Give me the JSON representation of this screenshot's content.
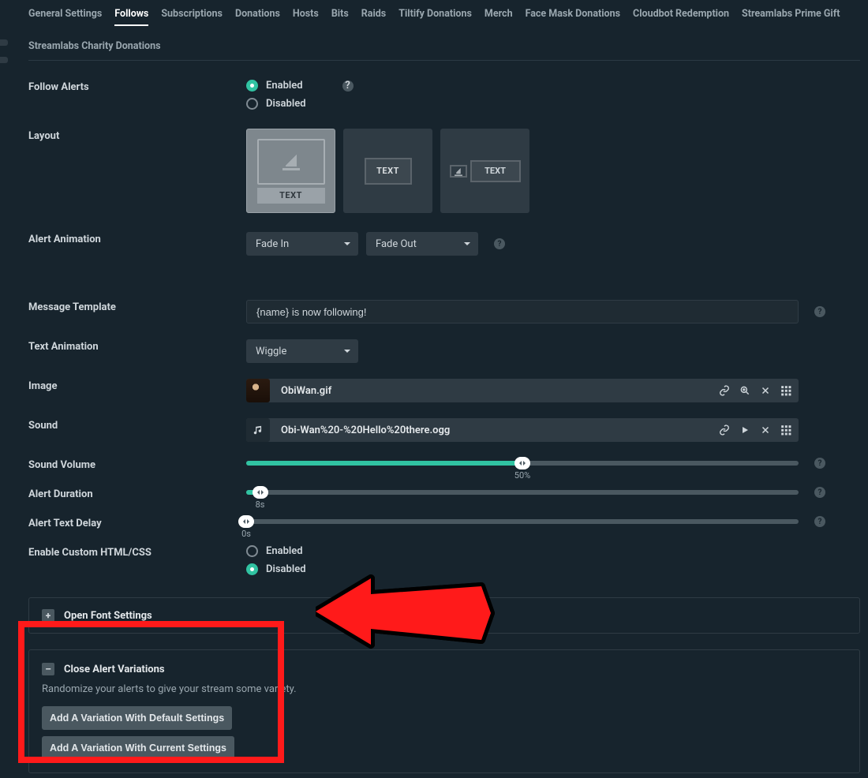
{
  "tabs": [
    "General Settings",
    "Follows",
    "Subscriptions",
    "Donations",
    "Hosts",
    "Bits",
    "Raids",
    "Tiltify Donations",
    "Merch",
    "Face Mask Donations",
    "Cloudbot Redemption",
    "Streamlabs Prime Gift",
    "Streamlabs Charity Donations"
  ],
  "active_tab": "Follows",
  "labels": {
    "follow_alerts": "Follow Alerts",
    "layout": "Layout",
    "alert_animation": "Alert Animation",
    "message_template": "Message Template",
    "text_animation": "Text Animation",
    "image": "Image",
    "sound": "Sound",
    "sound_volume": "Sound Volume",
    "alert_duration": "Alert Duration",
    "alert_text_delay": "Alert Text Delay",
    "custom_html": "Enable Custom HTML/CSS"
  },
  "radios": {
    "enabled": "Enabled",
    "disabled": "Disabled"
  },
  "follow_alerts_value": "Enabled",
  "custom_html_value": "Disabled",
  "layout_text": "TEXT",
  "alert_animation": {
    "in": "Fade In",
    "out": "Fade Out"
  },
  "message_template_value": "{name} is now following!",
  "text_animation_value": "Wiggle",
  "image_file": "ObiWan.gif",
  "sound_file": "Obi-Wan%20-%20Hello%20there.ogg",
  "sliders": {
    "volume": {
      "percent": 50,
      "label": "50%"
    },
    "duration": {
      "percent": 2.5,
      "label": "8s"
    },
    "delay": {
      "percent": 0,
      "label": "0s"
    }
  },
  "font_settings": {
    "title": "Open Font Settings",
    "toggle": "+"
  },
  "variations": {
    "title": "Close Alert Variations",
    "toggle": "–",
    "desc": "Randomize your alerts to give your stream some variety.",
    "btn_default": "Add A Variation With Default Settings",
    "btn_current": "Add A Variation With Current Settings"
  },
  "annotation": {
    "highlight_target": "variations-panel"
  }
}
